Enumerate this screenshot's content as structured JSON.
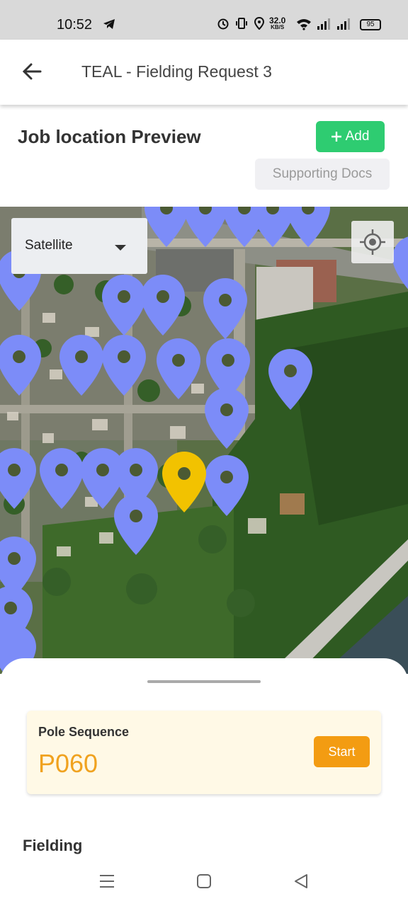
{
  "status_bar": {
    "time": "10:52",
    "net_speed_value": "32.0",
    "net_speed_unit": "KB/S",
    "battery": "95"
  },
  "app_bar": {
    "title": "TEAL - Fielding Request 3"
  },
  "job_location": {
    "title": "Job location Preview",
    "add_label": "Add",
    "supporting_docs_label": "Supporting Docs"
  },
  "map": {
    "type_selected": "Satellite",
    "marker_color": "#7c8cf8",
    "selected_marker_color": "#f2c200"
  },
  "sheet": {
    "pole_sequence_label": "Pole Sequence",
    "pole_sequence_value": "P060",
    "start_label": "Start",
    "fielding_label": "Fielding"
  },
  "colors": {
    "add_button": "#2ecc71",
    "start_button": "#f39c12",
    "pole_value": "#f0a21f"
  }
}
